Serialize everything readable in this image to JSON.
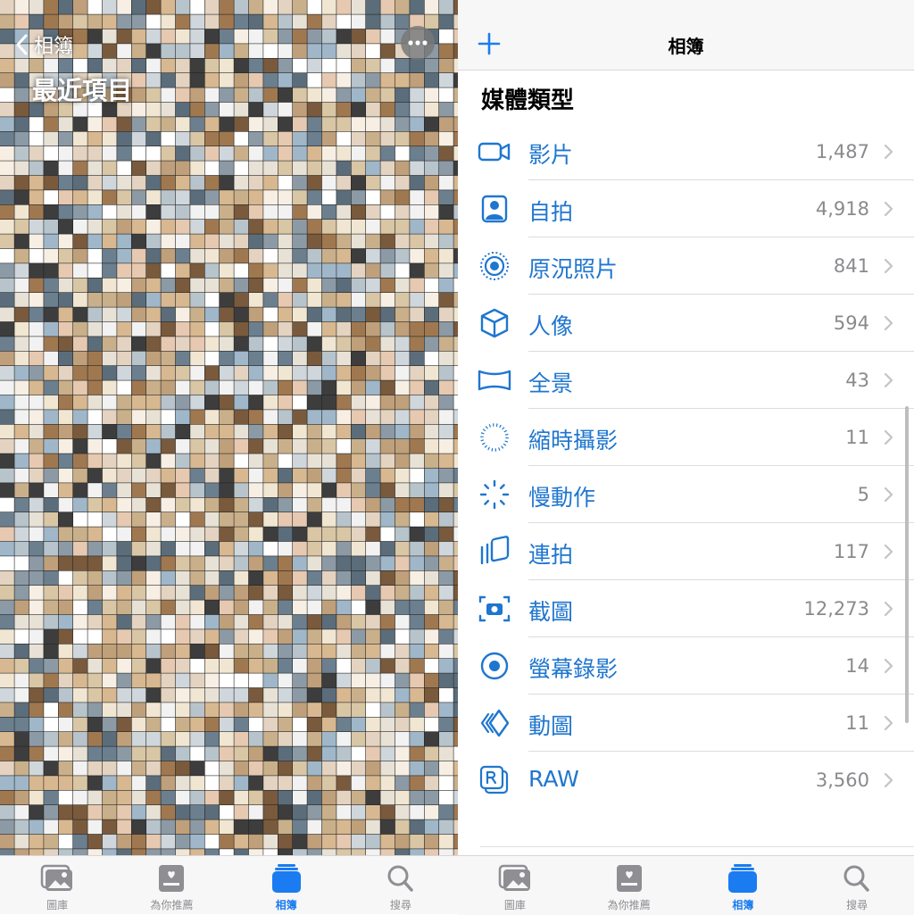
{
  "left_screen": {
    "back_label": "相簿",
    "title": "最近項目",
    "more_icon": "ellipsis-icon"
  },
  "right_screen": {
    "nav_title": "相簿",
    "add_icon": "plus-icon",
    "section_title": "媒體類型",
    "items": [
      {
        "label": "影片",
        "count": "1,487",
        "icon": "video-icon"
      },
      {
        "label": "自拍",
        "count": "4,918",
        "icon": "selfie-icon"
      },
      {
        "label": "原況照片",
        "count": "841",
        "icon": "live-photo-icon"
      },
      {
        "label": "人像",
        "count": "594",
        "icon": "portrait-cube-icon"
      },
      {
        "label": "全景",
        "count": "43",
        "icon": "panorama-icon"
      },
      {
        "label": "縮時攝影",
        "count": "11",
        "icon": "timelapse-icon"
      },
      {
        "label": "慢動作",
        "count": "5",
        "icon": "slow-motion-icon"
      },
      {
        "label": "連拍",
        "count": "117",
        "icon": "burst-icon"
      },
      {
        "label": "截圖",
        "count": "12,273",
        "icon": "screenshot-icon"
      },
      {
        "label": "螢幕錄影",
        "count": "14",
        "icon": "screen-recording-icon"
      },
      {
        "label": "動圖",
        "count": "11",
        "icon": "animated-icon"
      },
      {
        "label": "RAW",
        "count": "3,560",
        "icon": "raw-icon"
      }
    ]
  },
  "tabs": [
    {
      "label": "圖庫",
      "icon": "photo-library-icon",
      "active": false
    },
    {
      "label": "為你推薦",
      "icon": "for-you-icon",
      "active": false
    },
    {
      "label": "相簿",
      "icon": "albums-icon",
      "active": true
    },
    {
      "label": "搜尋",
      "icon": "search-icon",
      "active": false
    }
  ],
  "colors": {
    "accent": "#1f76cf",
    "tab_active": "#1a7cf0",
    "count_gray": "#8a8a8e"
  }
}
